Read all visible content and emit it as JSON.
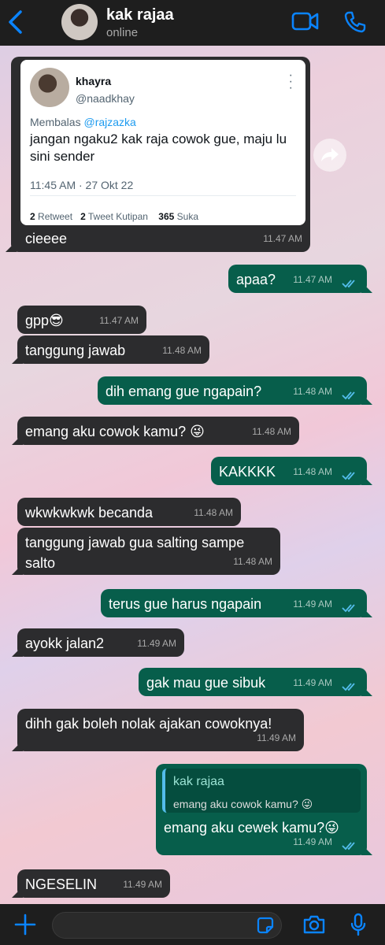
{
  "header": {
    "name": "kak rajaa",
    "status": "online"
  },
  "tweet": {
    "name": "khayra",
    "handle": "@naadkhay",
    "reply_prefix": "Membalas",
    "reply_to": "@rajzazka",
    "text": "jangan ngaku2 kak raja cowok gue, maju lu sini sender",
    "datetime": "11:45 AM · 27 Okt 22",
    "retweets": "2",
    "retweets_label": "Retweet",
    "quotes": "2",
    "quotes_label": "Tweet Kutipan",
    "likes": "365",
    "likes_label": "Suka"
  },
  "messages": [
    {
      "dir": "in",
      "text": "cieeee",
      "time": "11.47 AM"
    },
    {
      "dir": "out",
      "text": "apaa?",
      "time": "11.47 AM"
    },
    {
      "dir": "in",
      "text": "gpp😎",
      "time": "11.47 AM"
    },
    {
      "dir": "in",
      "text": "tanggung jawab",
      "time": "11.48 AM"
    },
    {
      "dir": "out",
      "text": "dih emang gue ngapain?",
      "time": "11.48 AM"
    },
    {
      "dir": "in",
      "text": "emang aku cowok kamu? 😜",
      "time": "11.48 AM"
    },
    {
      "dir": "out",
      "text": "KAKKKK",
      "time": "11.48 AM"
    },
    {
      "dir": "in",
      "text": "wkwkwkwk becanda",
      "time": "11.48 AM"
    },
    {
      "dir": "in",
      "text": "tanggung jawab gua salting sampe salto",
      "time": "11.48 AM"
    },
    {
      "dir": "out",
      "text": "terus gue harus ngapain",
      "time": "11.49 AM"
    },
    {
      "dir": "in",
      "text": "ayokk jalan2",
      "time": "11.49 AM"
    },
    {
      "dir": "out",
      "text": "gak mau gue sibuk",
      "time": "11.49 AM"
    },
    {
      "dir": "in",
      "text": "dihh gak boleh nolak ajakan cowoknya!",
      "time": "11.49 AM"
    },
    {
      "dir": "out",
      "text": "emang aku cewek kamu?😜",
      "time": "11.49 AM",
      "quote_name": "kak rajaa",
      "quote_text": "emang aku cowok kamu? 😜"
    },
    {
      "dir": "in",
      "text": "NGESELIN",
      "time": "11.49 AM"
    }
  ],
  "colors": {
    "incoming_bubble": "#2c2c2e",
    "outgoing_bubble": "#075e4b",
    "accent": "#0a84ff"
  },
  "icons": [
    "back-chevron-icon",
    "video-call-icon",
    "phone-icon",
    "forward-icon",
    "plus-icon",
    "sticker-icon",
    "camera-icon",
    "microphone-icon",
    "double-check-icon"
  ]
}
